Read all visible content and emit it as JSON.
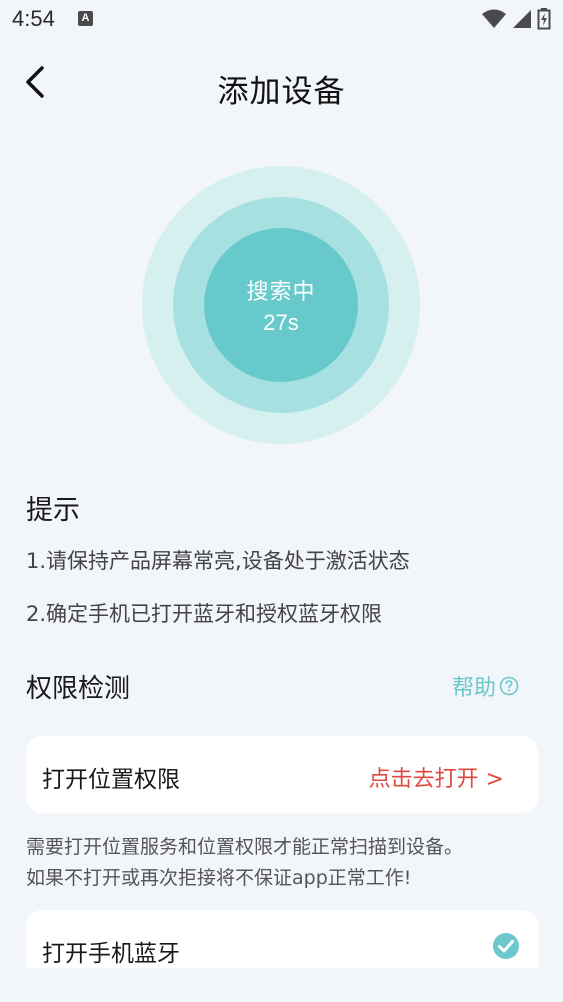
{
  "status": {
    "time": "4:54",
    "notification_badge": "A"
  },
  "nav": {
    "title": "添加设备"
  },
  "scan": {
    "label": "搜索中",
    "timer": "27s",
    "colors": {
      "outer": "#d6f0f0",
      "middle": "#a7e0e0",
      "inner": "#67c9cb"
    }
  },
  "tips": {
    "title": "提示",
    "items": [
      "1.请保持产品屏幕常亮,设备处于激活状态",
      "2.确定手机已打开蓝牙和授权蓝牙权限"
    ]
  },
  "permissions": {
    "title": "权限检测",
    "help_label": "帮助",
    "location": {
      "label": "打开位置权限",
      "action": "点击去打开 >"
    },
    "notice": [
      "需要打开位置服务和位置权限才能正常扫描到设备。",
      "如果不打开或再次拒接将不保证app正常工作!"
    ],
    "bluetooth": {
      "label": "打开手机蓝牙",
      "status_icon": "check-circle-icon"
    }
  },
  "accent_colors": {
    "teal": "#6cc8cb",
    "action_red": "#de4a3f"
  }
}
